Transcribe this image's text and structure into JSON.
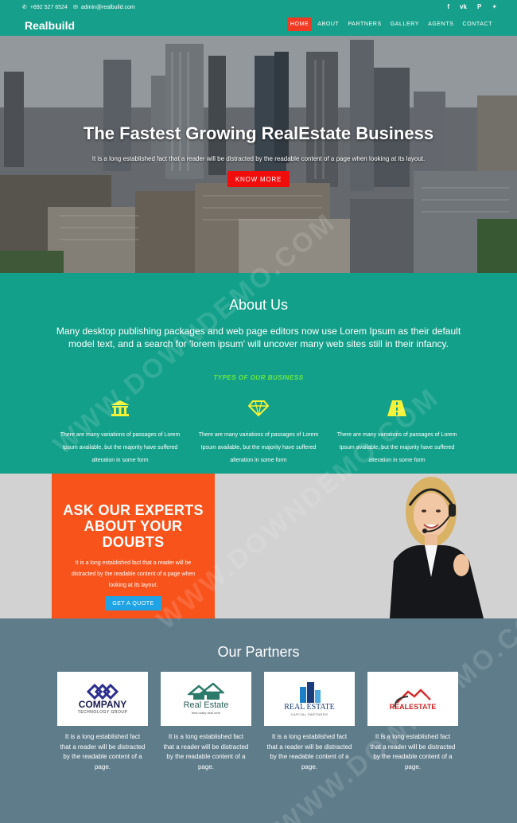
{
  "topbar": {
    "phone": "+692 527 6524",
    "email": "admin@realbuild.com",
    "social_icons": [
      "facebook-icon",
      "vk-icon",
      "pinterest-icon",
      "twitter-icon"
    ]
  },
  "nav": {
    "logo": "Realbuild",
    "items": [
      {
        "label": "HOME",
        "active": true
      },
      {
        "label": "ABOUT",
        "active": false
      },
      {
        "label": "PARTNERS",
        "active": false
      },
      {
        "label": "GALLERY",
        "active": false
      },
      {
        "label": "AGENTS",
        "active": false
      },
      {
        "label": "CONTACT",
        "active": false
      }
    ]
  },
  "hero": {
    "title": "The Fastest Growing RealEstate Business",
    "subtitle": "It is a long established fact that a reader will be distracted by the readable content of a page when looking at its layout.",
    "button": "KNOW MORE"
  },
  "about": {
    "title": "About Us",
    "text": "Many desktop publishing packages and web page editors now use Lorem Ipsum as their default model text, and a search for 'lorem ipsum' will uncover many web sites still in their infancy.",
    "types_label": "TYPES OF OUR BUSINESS",
    "features": [
      {
        "icon": "bank-icon",
        "text": "There are many variations of passages of Lorem Ipsum available, but the majority have suffered alteration in some form"
      },
      {
        "icon": "diamond-icon",
        "text": "There are many variations of passages of Lorem Ipsum available, but the majority have suffered alteration in some form"
      },
      {
        "icon": "road-icon",
        "text": "There are many variations of passages of Lorem Ipsum available, but the majority have suffered alteration in some form"
      }
    ]
  },
  "experts": {
    "heading": "ASK OUR EXPERTS ABOUT YOUR DOUBTS",
    "text": "It is a long established fact that a reader will be distracted by the readable content of a page when looking at its layout.",
    "button": "GET A QUOTE"
  },
  "partners": {
    "title": "Our Partners",
    "cards": [
      {
        "logo_main": "COMPANY",
        "logo_sub": "TECHNOLOGY GROUP",
        "text": "It is a long established fact that a reader will be distracted by the readable content of a page."
      },
      {
        "logo_main": "Real Estate",
        "logo_sub": "best realty deal here",
        "text": "It is a long established fact that a reader will be distracted by the readable content of a page."
      },
      {
        "logo_main": "REAL ESTATE",
        "logo_sub": "CAPITAL PARTNERS",
        "text": "It is a long established fact that a reader will be distracted by the readable content of a page."
      },
      {
        "logo_main": "REALESTATE",
        "logo_sub": "",
        "text": "It is a long established fact that a reader will be distracted by the readable content of a page."
      }
    ]
  },
  "watermark": "WWW.DOWNDEMO.COM",
  "colors": {
    "teal": "#16a08b",
    "red": "#f20d0d",
    "orange": "#f9531c",
    "blue": "#1fa3e5",
    "slate": "#5f7c8a",
    "green_label": "#6dea3e",
    "yellow_icon": "#f5f23a"
  }
}
